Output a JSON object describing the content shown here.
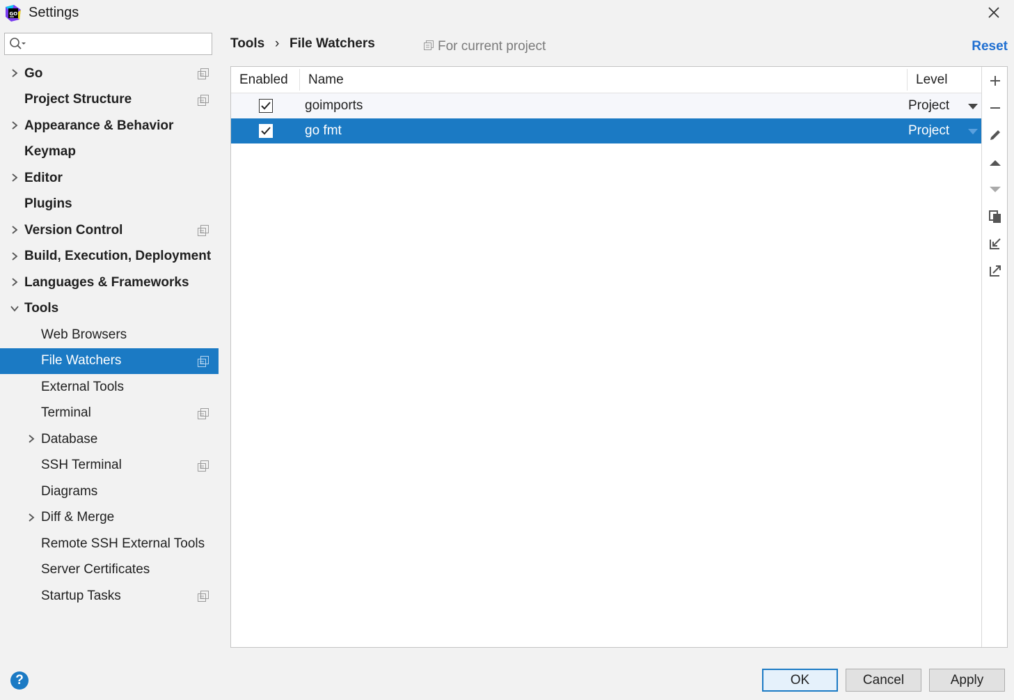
{
  "window": {
    "title": "Settings",
    "app_icon": "goland-app-icon",
    "close_icon": "close-icon"
  },
  "search": {
    "value": "",
    "placeholder": "",
    "icon": "search-icon"
  },
  "sidebar": {
    "items": [
      {
        "label": "Go",
        "bold": true,
        "arrow": "right",
        "project_icon": true
      },
      {
        "label": "Project Structure",
        "bold": true,
        "arrow": null,
        "project_icon": true
      },
      {
        "label": "Appearance & Behavior",
        "bold": true,
        "arrow": "right",
        "project_icon": false
      },
      {
        "label": "Keymap",
        "bold": true,
        "arrow": null,
        "project_icon": false
      },
      {
        "label": "Editor",
        "bold": true,
        "arrow": "right",
        "project_icon": false
      },
      {
        "label": "Plugins",
        "bold": true,
        "arrow": null,
        "project_icon": false
      },
      {
        "label": "Version Control",
        "bold": true,
        "arrow": "right",
        "project_icon": true
      },
      {
        "label": "Build, Execution, Deployment",
        "bold": true,
        "arrow": "right",
        "project_icon": false
      },
      {
        "label": "Languages & Frameworks",
        "bold": true,
        "arrow": "right",
        "project_icon": false
      },
      {
        "label": "Tools",
        "bold": true,
        "arrow": "down",
        "project_icon": false
      },
      {
        "label": "Web Browsers",
        "bold": false,
        "arrow": null,
        "project_icon": false
      },
      {
        "label": "File Watchers",
        "bold": false,
        "arrow": null,
        "project_icon": true,
        "selected": true
      },
      {
        "label": "External Tools",
        "bold": false,
        "arrow": null,
        "project_icon": false
      },
      {
        "label": "Terminal",
        "bold": false,
        "arrow": null,
        "project_icon": true
      },
      {
        "label": "Database",
        "bold": false,
        "arrow": "right",
        "project_icon": false
      },
      {
        "label": "SSH Terminal",
        "bold": false,
        "arrow": null,
        "project_icon": true
      },
      {
        "label": "Diagrams",
        "bold": false,
        "arrow": null,
        "project_icon": false
      },
      {
        "label": "Diff & Merge",
        "bold": false,
        "arrow": "right",
        "project_icon": false
      },
      {
        "label": "Remote SSH External Tools",
        "bold": false,
        "arrow": null,
        "project_icon": false
      },
      {
        "label": "Server Certificates",
        "bold": false,
        "arrow": null,
        "project_icon": false
      },
      {
        "label": "Startup Tasks",
        "bold": false,
        "arrow": null,
        "project_icon": true
      }
    ]
  },
  "header": {
    "breadcrumb": [
      "Tools",
      "File Watchers"
    ],
    "breadcrumb_separator": "›",
    "scope": "For current project",
    "reset": "Reset"
  },
  "table": {
    "columns": [
      "Enabled",
      "Name",
      "Level"
    ],
    "rows": [
      {
        "enabled": true,
        "name": "goimports",
        "level": "Project"
      },
      {
        "enabled": true,
        "name": "go fmt",
        "level": "Project",
        "selected": true
      }
    ]
  },
  "toolbar": {
    "icons": [
      "add-icon",
      "remove-icon",
      "edit-icon",
      "move-up-icon",
      "move-down-icon",
      "copy-icon",
      "import-icon",
      "export-icon"
    ]
  },
  "footer": {
    "help": "?",
    "ok": "OK",
    "cancel": "Cancel",
    "apply": "Apply"
  },
  "colors": {
    "selection": "#1b7ac4",
    "link": "#1f6fd1",
    "background": "#f2f2f2"
  }
}
